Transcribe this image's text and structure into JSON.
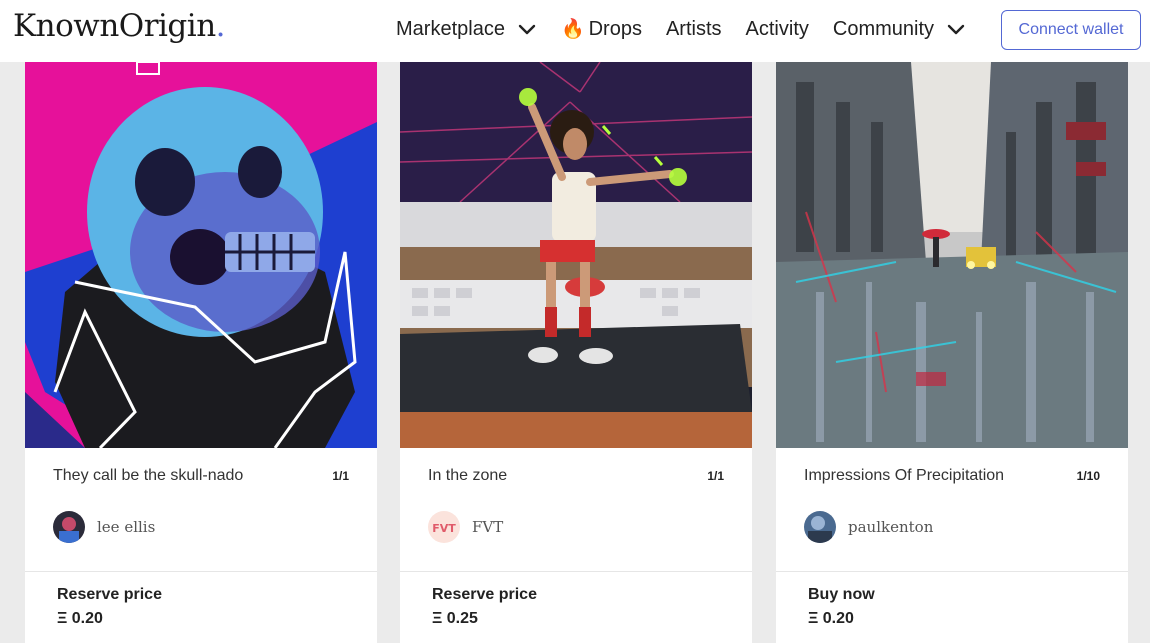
{
  "header": {
    "logo": "KnownOrigin",
    "logo_dot": ".",
    "nav": {
      "marketplace": "Marketplace",
      "drops": "Drops",
      "artists": "Artists",
      "activity": "Activity",
      "community": "Community"
    },
    "connect_wallet": "Connect wallet"
  },
  "cards": [
    {
      "title": "They call be the skull-nado",
      "edition": "1/1",
      "artist": "lee ellis",
      "price_label": "Reserve price",
      "price": "Ξ 0.20"
    },
    {
      "title": "In the zone",
      "edition": "1/1",
      "artist": "FVT",
      "avatar_text": "FVT",
      "price_label": "Reserve price",
      "price": "Ξ 0.25"
    },
    {
      "title": "Impressions Of Precipitation",
      "edition": "1/10",
      "artist": "paulkenton",
      "price_label": "Buy now",
      "price": "Ξ 0.20"
    }
  ],
  "colors": {
    "accent": "#5468d4",
    "background": "#ebebeb"
  }
}
